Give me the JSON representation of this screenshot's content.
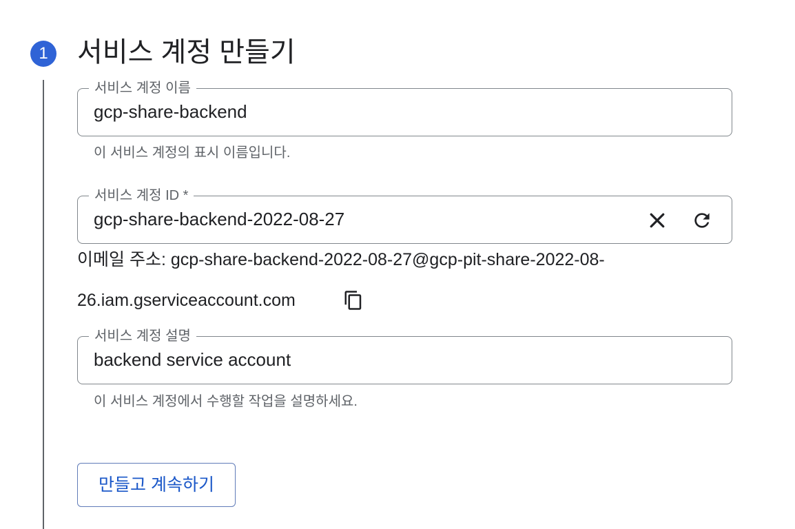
{
  "step": {
    "number": "1",
    "title": "서비스 계정 만들기"
  },
  "fields": {
    "name": {
      "label": "서비스 계정 이름",
      "value": "gcp-share-backend",
      "hint": "이 서비스 계정의 표시 이름입니다."
    },
    "id": {
      "label": "서비스 계정 ID *",
      "value": "gcp-share-backend-2022-08-27",
      "clear_icon": "close-icon",
      "refresh_icon": "refresh-icon",
      "email_line1": "이메일 주소: gcp-share-backend-2022-08-27@gcp-pit-share-2022-08-",
      "email_line2": "26.iam.gserviceaccount.com",
      "copy_icon": "copy-icon"
    },
    "description": {
      "label": "서비스 계정 설명",
      "value": "backend service account",
      "hint": "이 서비스 계정에서 수행할 작업을 설명하세요."
    }
  },
  "actions": {
    "create_continue_label": "만들고 계속하기"
  },
  "colors": {
    "accent": "#2f63d6",
    "button_text": "#1a57c8",
    "border": "#80868b",
    "hint_text": "#5f6368"
  }
}
